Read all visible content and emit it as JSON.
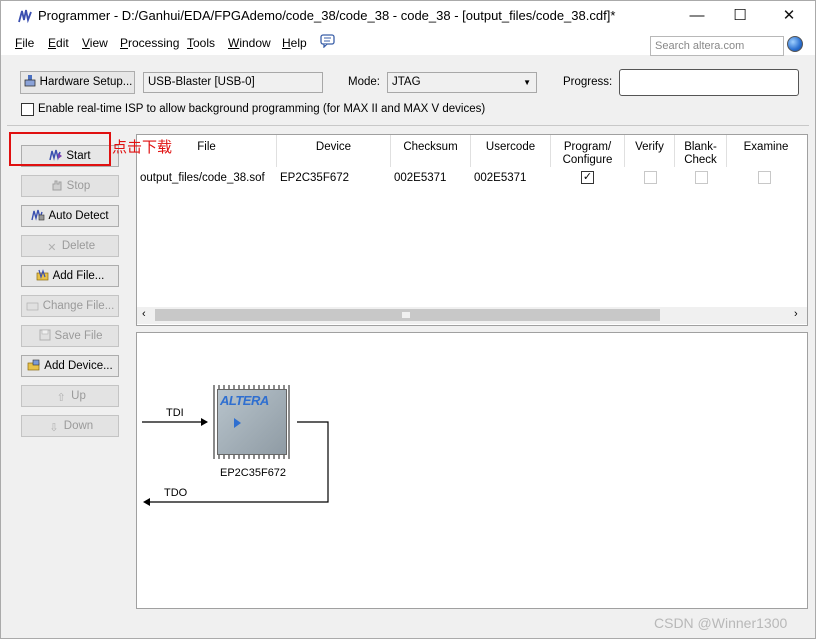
{
  "window": {
    "title": "Programmer - D:/Ganhui/EDA/FPGAdemo/code_38/code_38 - code_38 - [output_files/code_38.cdf]*",
    "minimize": "—",
    "maximize": "☐",
    "close": "✕"
  },
  "menu": {
    "file": {
      "key": "F",
      "rest": "ile"
    },
    "edit": {
      "key": "E",
      "rest": "dit"
    },
    "view": {
      "key": "V",
      "rest": "iew"
    },
    "processing": {
      "key": "P",
      "rest": "rocessing"
    },
    "tools": {
      "key": "T",
      "rest": "ools"
    },
    "window": {
      "key": "W",
      "rest": "indow"
    },
    "help": {
      "key": "H",
      "rest": "elp"
    }
  },
  "search": {
    "placeholder": "Search altera.com"
  },
  "hardware": {
    "setup_label": "Hardware Setup...",
    "device_value": "USB-Blaster [USB-0]",
    "mode_label": "Mode:",
    "mode_value": "JTAG",
    "progress_label": "Progress:",
    "progress": 0,
    "isp_label": "Enable real-time ISP to allow background programming (for MAX II and MAX V devices)"
  },
  "side_buttons": {
    "start": "Start",
    "stop": "Stop",
    "auto_detect": "Auto Detect",
    "delete": "Delete",
    "add_file": "Add File...",
    "change_file": "Change File...",
    "save_file": "Save File",
    "add_device": "Add Device...",
    "up": "Up",
    "down": "Down"
  },
  "table": {
    "headers": {
      "file": "File",
      "device": "Device",
      "checksum": "Checksum",
      "usercode": "Usercode",
      "program_1": "Program/",
      "program_2": "Configure",
      "verify": "Verify",
      "blank_1": "Blank-",
      "blank_2": "Check",
      "examine": "Examine"
    },
    "rows": [
      {
        "file": "output_files/code_38.sof",
        "device": "EP2C35F672",
        "checksum": "002E5371",
        "usercode": "002E5371",
        "program": true,
        "verify": false,
        "blank_check": false,
        "examine": false
      }
    ]
  },
  "chain": {
    "tdi": "TDI",
    "tdo": "TDO",
    "chip_logo": "ALTERA",
    "chip_device": "EP2C35F672"
  },
  "annotation": {
    "text": "点击下载",
    "color": "#e01010"
  },
  "watermark": "CSDN @Winner1300"
}
